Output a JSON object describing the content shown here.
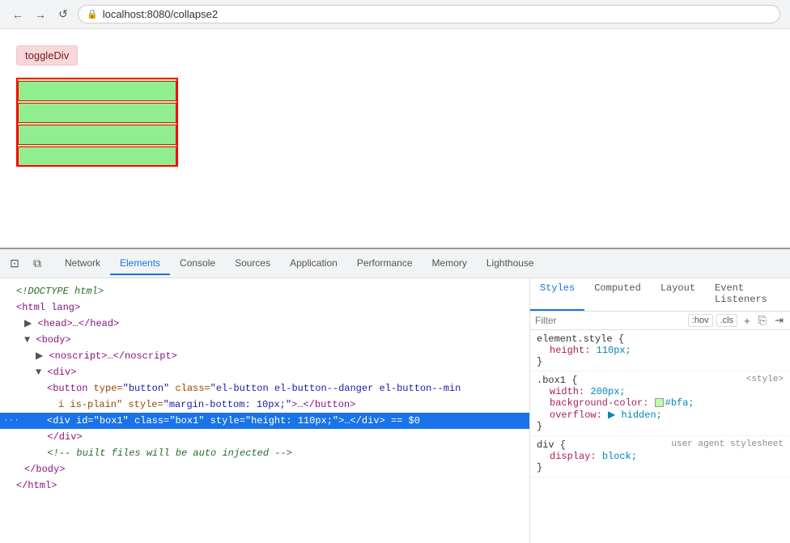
{
  "browser": {
    "back_label": "←",
    "forward_label": "→",
    "reload_label": "↺",
    "url": "localhost:8080/collapse2",
    "lock_icon": "🔒"
  },
  "page": {
    "toggle_button": "toggleDiv"
  },
  "devtools": {
    "tabs": [
      "Network",
      "Elements",
      "Console",
      "Sources",
      "Application",
      "Performance",
      "Memory",
      "Lighthouse"
    ],
    "active_tab": "Elements",
    "styles_tabs": [
      "Styles",
      "Computed",
      "Layout",
      "Event Listeners"
    ],
    "active_styles_tab": "Styles",
    "filter_placeholder": "Filter",
    "hov_label": ":hov",
    "cls_label": ".cls",
    "dom": {
      "line1": "<!DOCTYPE html>",
      "line2": "<html lang>",
      "line3": "▶ <head>…</head>",
      "line4": "▼ <body>",
      "line5": "▶ <noscript>…</noscript>",
      "line6": "▼ <div>",
      "line7_pre": "<button type=\"button\" class=\"el-button el-button--danger el-button--min",
      "line7_post": " i is-plain\" style=\"margin-bottom: 10px;\">…</button>",
      "line8_pre": "<div id=\"box1\" class=\"box1\" style=\"height: 110px;\">…</div>",
      "line8_dollar": "== $0",
      "line9": "</div>",
      "line10": "<!-- built files will be auto injected -->",
      "line11": "</body>",
      "line12": "</html>"
    },
    "styles": {
      "element_style_selector": "element.style {",
      "element_prop1": "height:",
      "element_val1": "110px;",
      "box1_selector": ".box1 {",
      "box1_source": "<style>",
      "box1_prop1": "width:",
      "box1_val1": "200px;",
      "box1_prop2": "background-color:",
      "box1_val2": "#bfa;",
      "box1_prop3": "overflow:",
      "box1_val3": "▶ hidden;",
      "div_selector": "div {",
      "div_source": "user agent stylesheet",
      "div_prop1": "display:",
      "div_val1": "block;"
    }
  }
}
